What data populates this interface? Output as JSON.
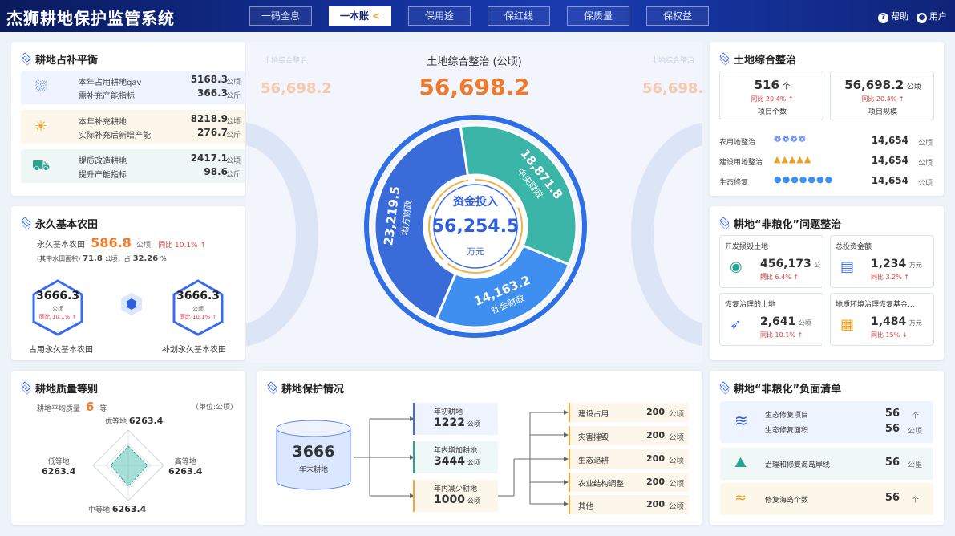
{
  "app": {
    "title": "杰狮耕地保护监管系统"
  },
  "nav": [
    {
      "label": "一码全息"
    },
    {
      "label": "一本账",
      "chev": "<"
    },
    {
      "label": "保用途"
    },
    {
      "label": "保红线"
    },
    {
      "label": "保质量"
    },
    {
      "label": "保权益"
    }
  ],
  "header_right": {
    "help": "帮助",
    "user": "用户",
    "help_icon": "?"
  },
  "balance": {
    "title": "耕地占补平衡",
    "rows": [
      {
        "l1": "本年占用耕地qav",
        "v1": "5168.3",
        "u1": "公顷",
        "l2": "需补充产能指标",
        "v2": "366.3",
        "u2": "公斤",
        "icon": "farmland-icon"
      },
      {
        "l1": "本年补充耕地",
        "v1": "8218.9",
        "u1": "公顷",
        "l2": "实际补充后新增产能",
        "v2": "276.7",
        "u2": "公斤",
        "icon": "sun-icon"
      },
      {
        "l1": "提质改造耕地",
        "v1": "2417.1",
        "u1": "公顷",
        "l2": "提升产能指标",
        "v2": "98.6",
        "u2": "公斤",
        "icon": "tractor-icon"
      }
    ]
  },
  "basic": {
    "title": "永久基本农田",
    "label": "永久基本农田",
    "value": "586.8",
    "unit": "公顷",
    "yoy": "同比 10.1% ↑",
    "sub_label": "(其中水田面积)",
    "sub_value": "71.8",
    "sub_unit": "公顷，占",
    "sub_pct": "32.26",
    "sub_pct_unit": "%",
    "left": {
      "value": "3666.3",
      "unit": "公顷",
      "yoy": "同比 10.1% ↑",
      "caption": "占用永久基本农田"
    },
    "right": {
      "value": "3666.3",
      "unit": "公顷",
      "yoy": "同比 10.1% ↑",
      "caption": "补划永久基本农田"
    }
  },
  "quality": {
    "title": "耕地质量等别",
    "avg_label": "耕地平均质量",
    "avg_value": "6",
    "avg_unit": "等",
    "unit_note": "（单位:公顷）",
    "labels": {
      "top_label": "优等地",
      "top_value": "6263.4",
      "left_label": "低等地",
      "left_value": "6263.4",
      "right_label": "高等地",
      "right_value": "6263.4",
      "bottom_label": "中等地",
      "bottom_value": "6263.4"
    }
  },
  "center": {
    "title": "土地综合整治 (公顷)",
    "total": "56,698.2",
    "side_total": "56,698.2",
    "side_title": "土地综合整治",
    "inner_label": "资金投入",
    "inner_value": "56,254.5",
    "inner_unit": "万元",
    "segments": [
      {
        "value": "18,871.8",
        "name": "中央财政",
        "color": "#3bb5a8"
      },
      {
        "value": "14,163.2",
        "name": "社会财政",
        "color": "#3f8ff0"
      },
      {
        "value": "23,219.5",
        "name": "地方财政",
        "color": "#3a6cd9"
      }
    ]
  },
  "land": {
    "title": "土地综合整治",
    "count": "516",
    "count_unit": "个",
    "count_yoy": "同比 20.4% ↑",
    "count_label": "项目个数",
    "scale": "56,698.2",
    "scale_unit": "公顷",
    "scale_yoy": "同比 20.4% ↑",
    "scale_label": "项目规模",
    "rows": [
      {
        "label": "农用地整治",
        "value": "14,654",
        "unit": "公顷",
        "glyph": "❁",
        "n": 4,
        "color": "#3b6cf0"
      },
      {
        "label": "建设用地整治",
        "value": "14,654",
        "unit": "公顷",
        "glyph": "▲",
        "n": 5,
        "color": "#f0a020"
      },
      {
        "label": "生态修复",
        "value": "14,654",
        "unit": "公顷",
        "glyph": "●",
        "n": 7,
        "color": "#3b8ff0"
      }
    ]
  },
  "nongrain": {
    "title": "耕地“非粮化”问题整治",
    "items": [
      {
        "label": "开发损毁土地",
        "value": "456,173",
        "unit": "公顷",
        "yoy": "同比 6.4% ↑",
        "down": false
      },
      {
        "label": "总投资金额",
        "value": "1,234",
        "unit": "万元",
        "yoy": "同比 3.2% ↑",
        "down": false
      },
      {
        "label": "恢复治理的土地",
        "value": "2,641",
        "unit": "公顷",
        "yoy": "同比 10.1% ↑",
        "down": false
      },
      {
        "label": "地质环境治理恢复基金...",
        "value": "1,484",
        "unit": "万元",
        "yoy": "同比 15% ↓",
        "down": true
      }
    ]
  },
  "protect": {
    "title": "耕地保护情况",
    "cyl_value": "3666",
    "cyl_label": "年末耕地",
    "boxes": [
      {
        "label": "年初耕地",
        "value": "1222",
        "unit": "公顷"
      },
      {
        "label": "年内增加耕地",
        "value": "3444",
        "unit": "公顷"
      },
      {
        "label": "年内减少耕地",
        "value": "1000",
        "unit": "公顷"
      }
    ],
    "items": [
      {
        "label": "建设占用",
        "value": "200",
        "unit": "公顷"
      },
      {
        "label": "灾害摧毁",
        "value": "200",
        "unit": "公顷"
      },
      {
        "label": "生态退耕",
        "value": "200",
        "unit": "公顷"
      },
      {
        "label": "农业结构调整",
        "value": "200",
        "unit": "公顷"
      },
      {
        "label": "其他",
        "value": "200",
        "unit": "公顷"
      }
    ]
  },
  "negative": {
    "title": "耕地“非粮化”负面清单",
    "rows": [
      {
        "l1": "生态修复项目",
        "v1": "56",
        "u1": "个",
        "l2": "生态修复面积",
        "v2": "56",
        "u2": "公顷",
        "bg": "#eef4ff"
      },
      {
        "l1": "治理和修复海岛岸线",
        "v1": "56",
        "u1": "公里",
        "bg": "#eff8f6"
      },
      {
        "l1": "修复海岛个数",
        "v1": "56",
        "u1": "个",
        "bg": "#fdf7ea"
      }
    ]
  }
}
